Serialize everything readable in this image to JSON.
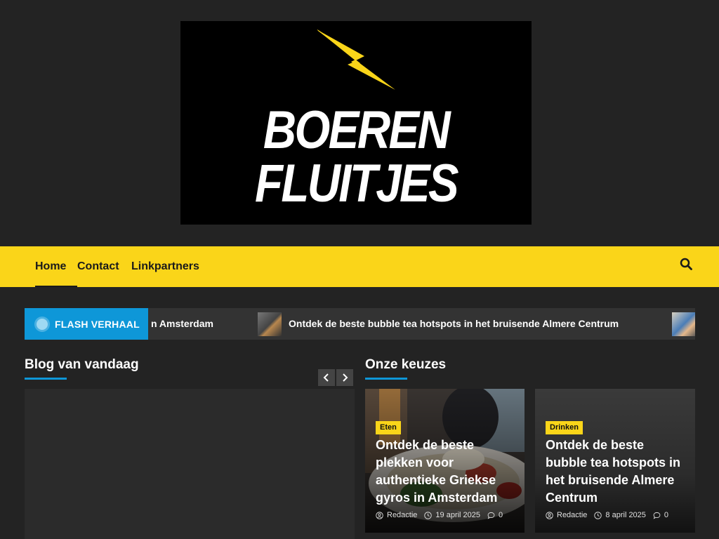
{
  "logo": {
    "line1": "BOEREN",
    "line2": "FLUITJES"
  },
  "nav": {
    "items": [
      {
        "label": "Home"
      },
      {
        "label": "Contact"
      },
      {
        "label": "Linkpartners"
      }
    ],
    "active": "Home"
  },
  "flash": {
    "label": "FLASH VERHAAL",
    "items": [
      {
        "text": "n Amsterdam"
      },
      {
        "text": "Ontdek de beste bubble tea hotspots in het bruisende Almere Centrum"
      }
    ]
  },
  "blog": {
    "title": "Blog van vandaag"
  },
  "keuzes": {
    "title": "Onze keuzes",
    "cards": [
      {
        "category": "Eten",
        "title": "Ontdek de beste plekken voor authentieke Griekse gyros in Amsterdam",
        "author": "Redactie",
        "date": "19 april 2025",
        "comments": "0"
      },
      {
        "category": "Drinken",
        "title": "Ontdek de beste bubble tea hotspots in het bruisende Almere Centrum",
        "author": "Redactie",
        "date": "8 april 2025",
        "comments": "0"
      }
    ]
  },
  "colors": {
    "accent": "#fad519",
    "blue": "#0e97d8",
    "background": "#232323"
  }
}
